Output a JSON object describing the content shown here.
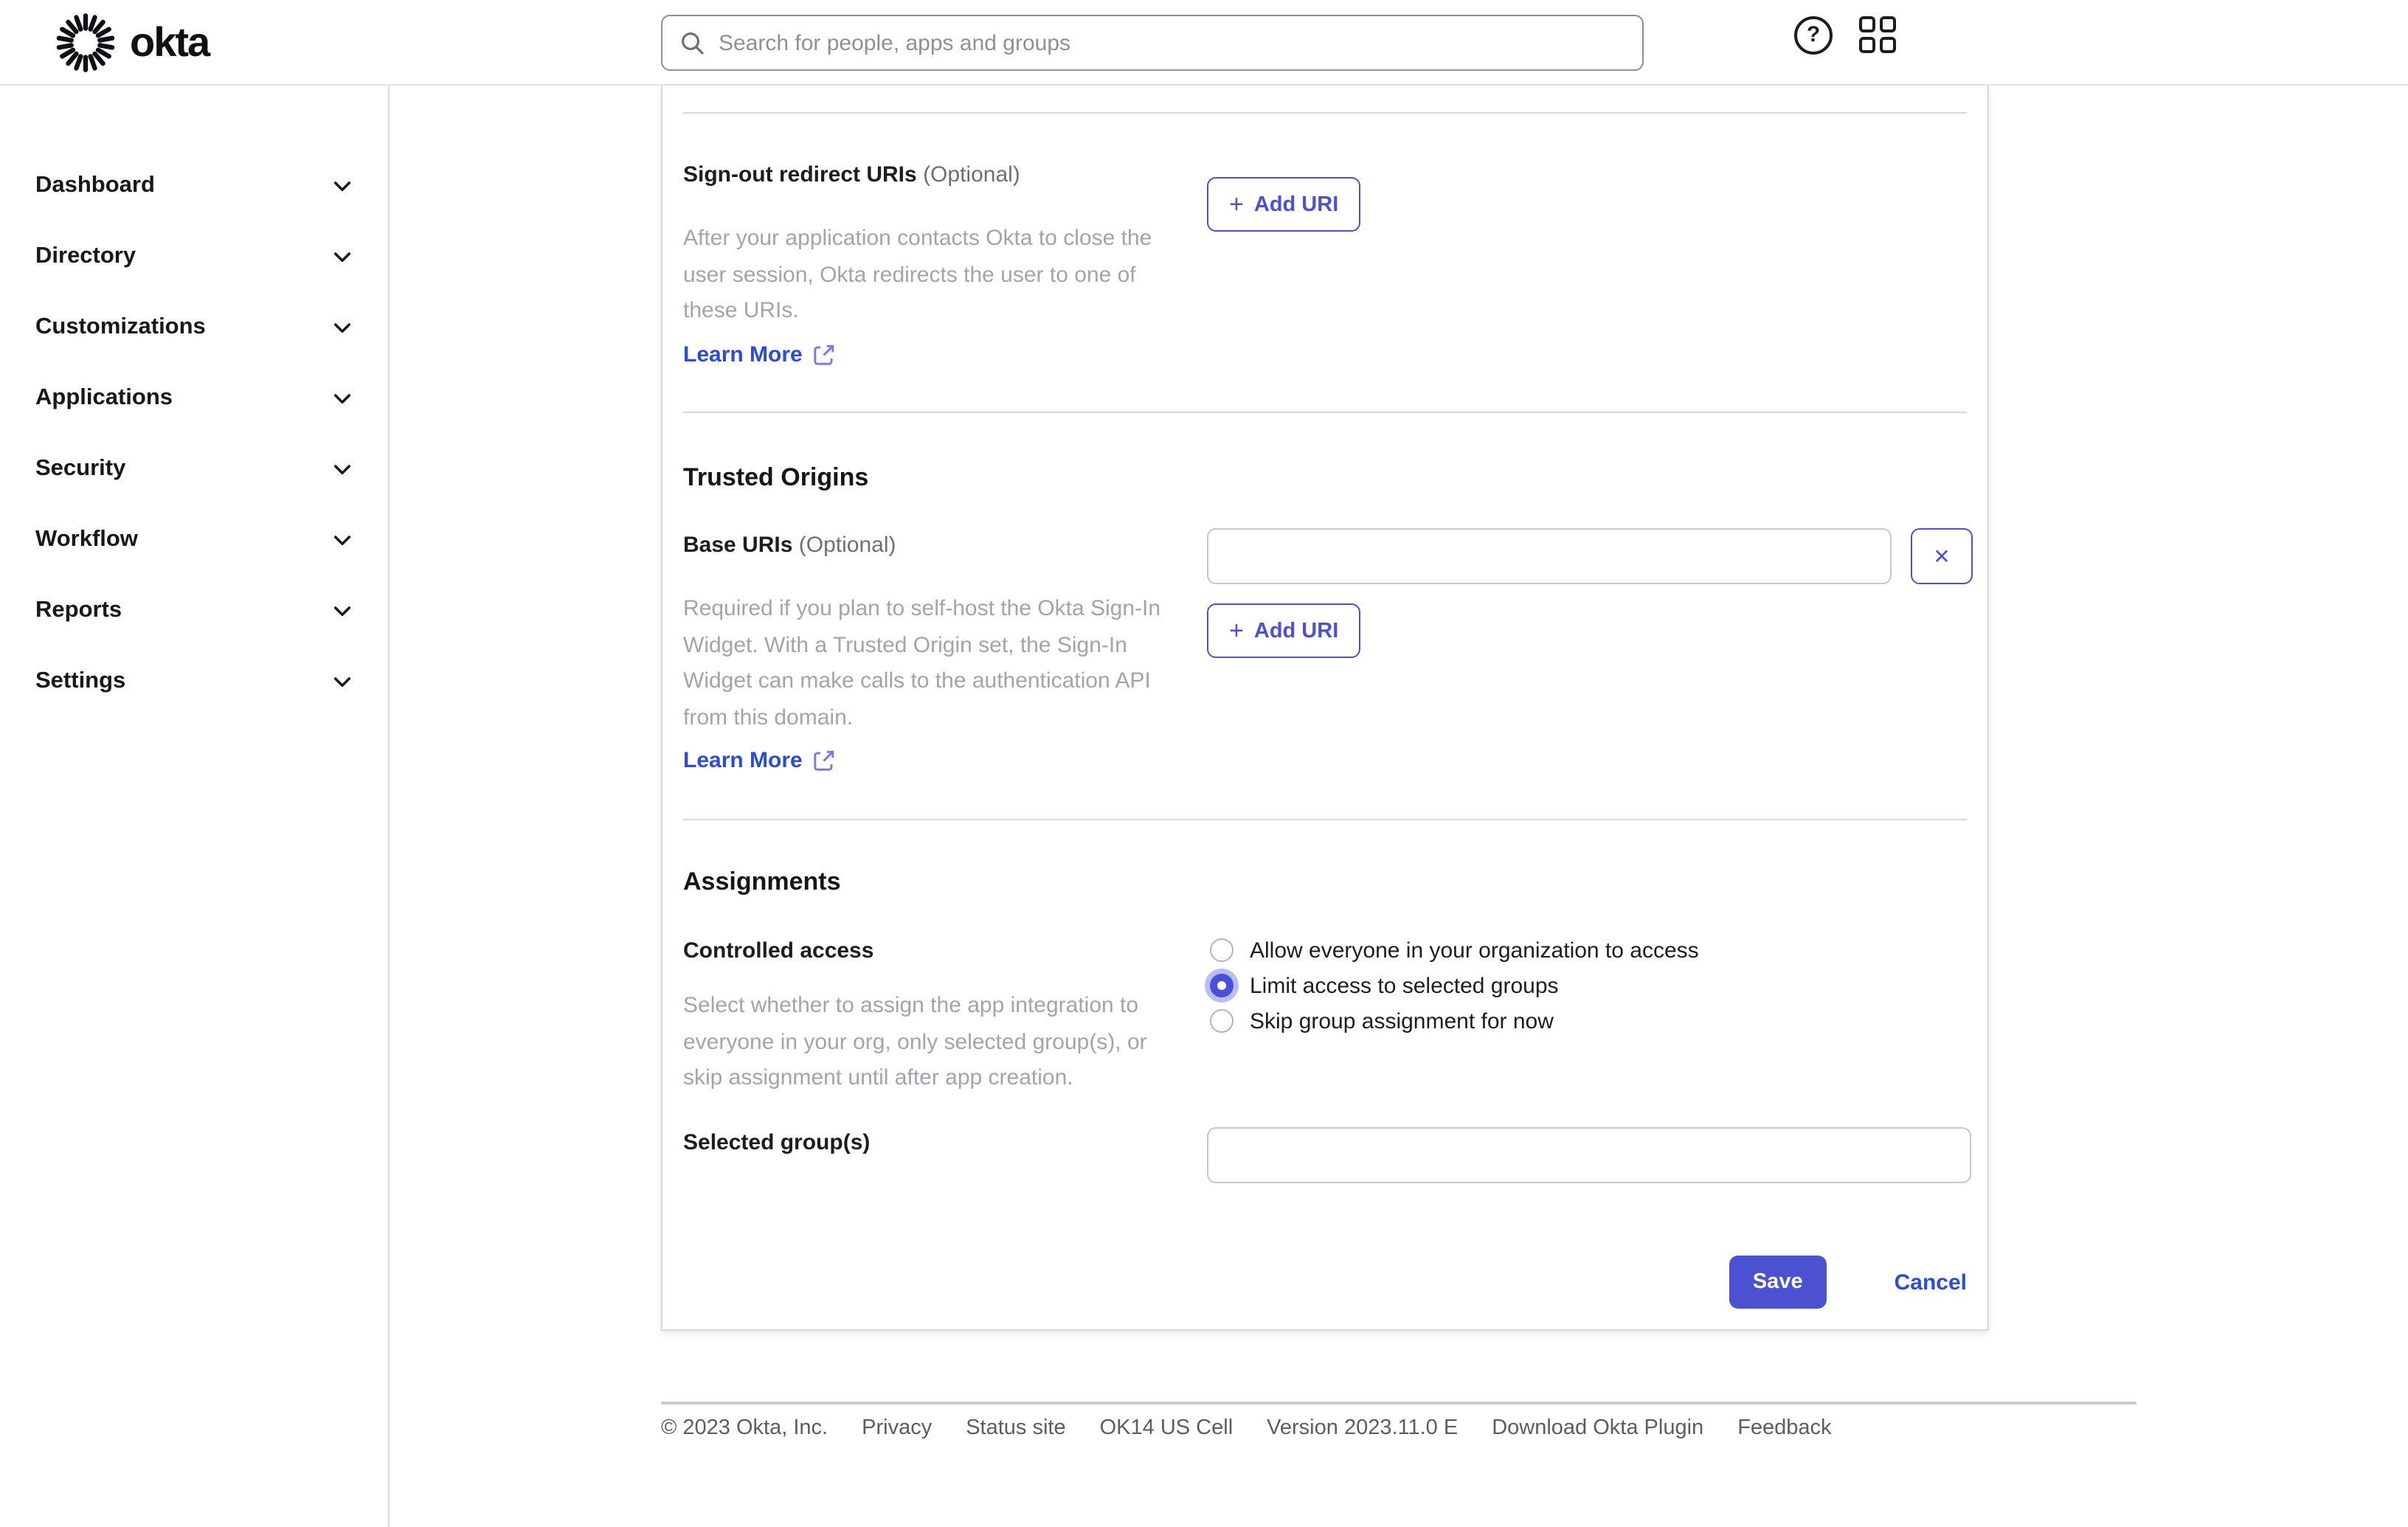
{
  "header": {
    "brand": "okta",
    "search": {
      "placeholder": "Search for people, apps and groups",
      "value": ""
    },
    "help_icon": "question-mark-circle",
    "apps_icon": "grid-2x2"
  },
  "sidebar": {
    "items": [
      {
        "label": "Dashboard"
      },
      {
        "label": "Directory"
      },
      {
        "label": "Customizations"
      },
      {
        "label": "Applications"
      },
      {
        "label": "Security"
      },
      {
        "label": "Workflow"
      },
      {
        "label": "Reports"
      },
      {
        "label": "Settings"
      }
    ]
  },
  "main": {
    "signout_section": {
      "label": "Sign-out redirect URIs",
      "optional": "(Optional)",
      "description": "After your application contacts Okta to close the user session, Okta redirects the user to one of these URIs.",
      "learn_more": "Learn More",
      "add_uri_label": "Add URI"
    },
    "trusted_origins": {
      "heading": "Trusted Origins",
      "base_uris_label": "Base URIs",
      "optional": "(Optional)",
      "base_uri_value": "",
      "description": "Required if you plan to self-host the Okta Sign-In Widget. With a Trusted Origin set, the Sign-In Widget can make calls to the authentication API from this domain.",
      "learn_more": "Learn More",
      "add_uri_label": "Add URI"
    },
    "assignments": {
      "heading": "Assignments",
      "controlled_access_label": "Controlled access",
      "description": "Select whether to assign the app integration to everyone in your org, only selected group(s), or skip assignment until after app creation.",
      "options": [
        {
          "label": "Allow everyone in your organization to access",
          "selected": false
        },
        {
          "label": "Limit access to selected groups",
          "selected": true
        },
        {
          "label": "Skip group assignment for now",
          "selected": false
        }
      ],
      "selected_groups_label": "Selected group(s)",
      "selected_groups_value": ""
    },
    "actions": {
      "save": "Save",
      "cancel": "Cancel"
    }
  },
  "footer": {
    "items": [
      "© 2023 Okta, Inc.",
      "Privacy",
      "Status site",
      "OK14 US Cell",
      "Version 2023.11.0 E",
      "Download Okta Plugin",
      "Feedback"
    ]
  },
  "colors": {
    "accent": "#4a52d1",
    "link": "#2d4bd7",
    "link_icon": "#7b7be8",
    "text": "#1d1d21",
    "muted_text": "#a2a4ab",
    "optional_text": "#6e6e78",
    "divider": "#dadade",
    "input_border": "#c6c6cc",
    "footer_text": "#5c5c64"
  }
}
